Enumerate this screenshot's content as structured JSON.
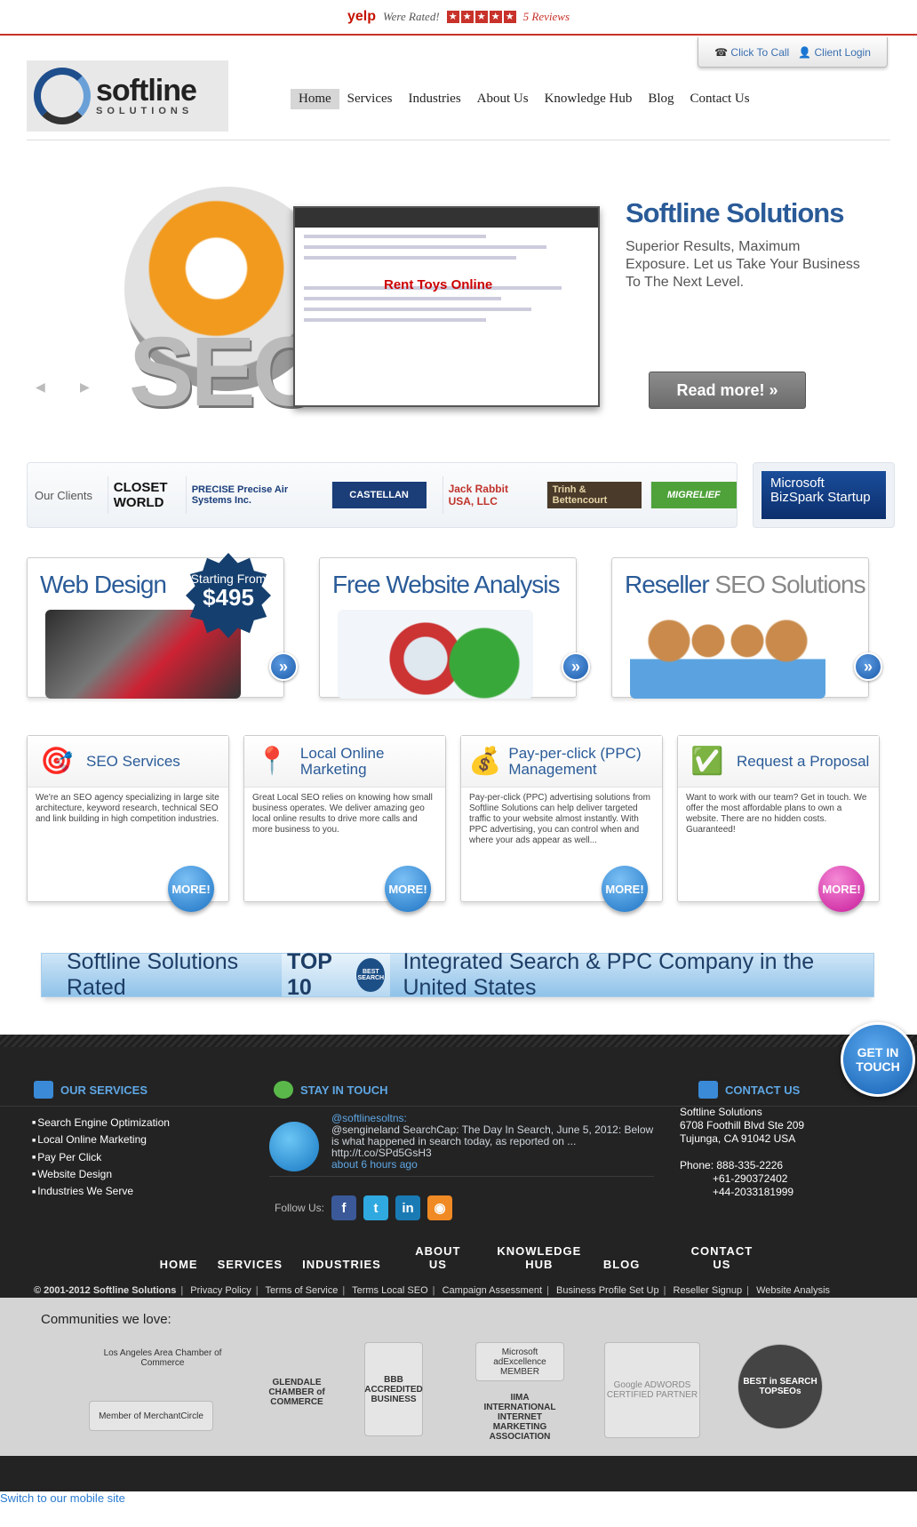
{
  "topbar": {
    "yelp": "yelp",
    "rated": "Were Rated!",
    "reviews": "5 Reviews"
  },
  "callbox": {
    "call": "Click To Call",
    "login": "Client Login"
  },
  "logo": {
    "name": "softline",
    "tag": "SOLUTIONS"
  },
  "nav": [
    "Home",
    "Services",
    "Industries",
    "About Us",
    "Knowledge Hub",
    "Blog",
    "Contact Us"
  ],
  "hero": {
    "title": "Softline Solutions",
    "subtitle": "Superior Results, Maximum Exposure. Let us Take Your Business To The Next Level.",
    "button": "Read more! »",
    "image_text": "SEO",
    "screen_text": "Rent Toys Online"
  },
  "clients": {
    "label": "Our Clients",
    "logos": [
      "CLOSET WORLD",
      "PRECISE Precise Air Systems Inc.",
      "CASTELLAN",
      "Jack Rabbit USA, LLC",
      "Trinh & Bettencourt",
      "MIGRELIEF"
    ],
    "bizspark": "Microsoft BizSpark Startup"
  },
  "promos": [
    {
      "title": "Web Design",
      "title_gray": "",
      "badge_top": "Starting From",
      "badge_price": "$495"
    },
    {
      "title": "Free",
      "title_gray": "Website Analysis"
    },
    {
      "title": "Reseller",
      "title_gray": "SEO Solutions"
    }
  ],
  "services": [
    {
      "title": "SEO Services",
      "text": "We're an SEO agency specializing in large site architecture, keyword research, technical SEO and link building in high competition industries.",
      "more": "MORE!"
    },
    {
      "title": "Local Online Marketing",
      "text": "Great Local SEO relies on knowing how small business operates. We deliver amazing geo local online results to drive more calls and more business to you.",
      "more": "MORE!"
    },
    {
      "title": "Pay-per-click (PPC) Management",
      "text": "Pay-per-click (PPC) advertising solutions from Softline Solutions can help deliver targeted traffic to your website almost instantly. With PPC advertising, you can control when and where your ads appear as well...",
      "more": "MORE!"
    },
    {
      "title": "Request a Proposal",
      "text": "Want to work with our team? Get in touch. We offer the most affordable plans to own a website. There are no hidden costs. Guaranteed!",
      "more": "MORE!"
    }
  ],
  "banner": {
    "left": "Softline Solutions Rated",
    "top10": "TOP 10",
    "seal": "BEST SEARCH",
    "right": "Integrated Search & PPC Company in the United States"
  },
  "footer": {
    "services_head": "OUR SERVICES",
    "services": [
      "Search Engine Optimization",
      "Local Online Marketing",
      "Pay Per Click",
      "Website Design",
      "Industries We Serve"
    ],
    "stay_head": "STAY IN TOUCH",
    "tweet_user": "@softlinesoltns:",
    "tweet_text": "@sengineland SearchCap: The Day In Search, June 5, 2012: Below is what happened in search today, as reported on ... http://t.co/SPd5GsH3",
    "tweet_time": "about 6 hours ago",
    "follow": "Follow Us:",
    "contact_head": "CONTACT US",
    "contact_lines": [
      "Softline Solutions",
      "6708 Foothill Blvd Ste 209",
      "Tujunga, CA 91042 USA"
    ],
    "phone_label": "Phone: 888-335-2226",
    "phones": [
      "+61-290372402",
      "+44-2033181999"
    ],
    "get_in_touch": "GET IN TOUCH",
    "nav": [
      "HOME",
      "SERVICES",
      "INDUSTRIES",
      "ABOUT US",
      "KNOWLEDGE HUB",
      "BLOG",
      "CONTACT US"
    ],
    "copyright": "© 2001-2012 Softline Solutions",
    "links": [
      "Privacy Policy",
      "Terms of Service",
      "Terms Local SEO",
      "Campaign Assessment",
      "Business Profile Set Up",
      "Reseller Signup",
      "Website Analysis"
    ]
  },
  "communities": {
    "title": "Communities we love:",
    "logos": [
      "Los Angeles Area Chamber of Commerce",
      "Member of MerchantCircle",
      "GLENDALE CHAMBER of COMMERCE",
      "BBB ACCREDITED BUSINESS",
      "Microsoft adExcellence MEMBER",
      "IIMA INTERNATIONAL INTERNET MARKETING ASSOCIATION",
      "Google ADWORDS CERTIFIED PARTNER",
      "BEST in SEARCH TOPSEOs"
    ]
  },
  "mobile_link": "Switch to our mobile site",
  "colors": {
    "accent": "#2a5b98",
    "yelp_red": "#c8322a",
    "footer_bg": "#232323"
  }
}
